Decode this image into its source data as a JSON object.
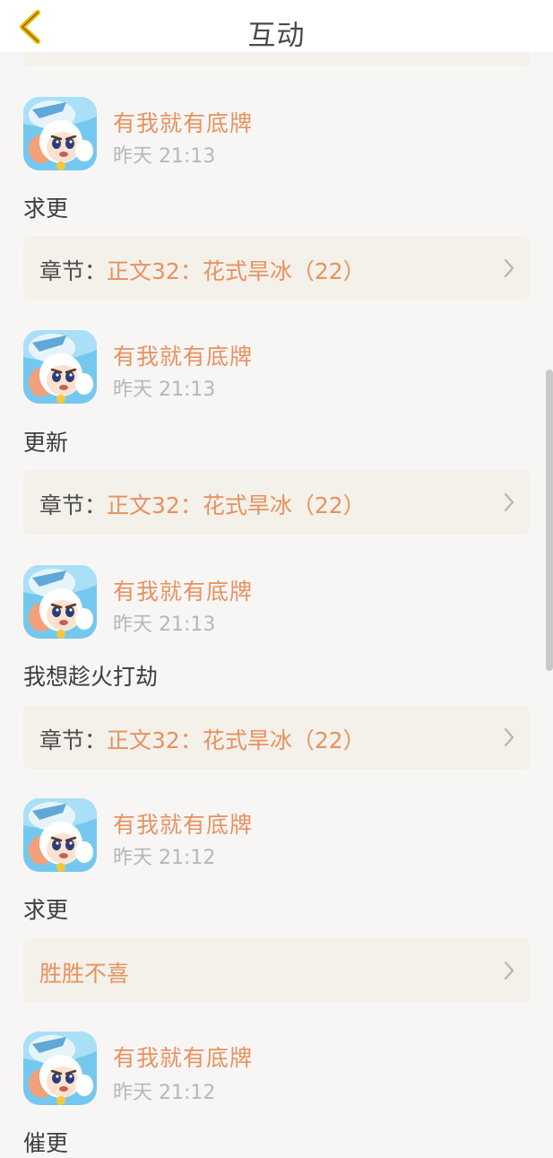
{
  "header": {
    "title": "互动"
  },
  "items": [
    {
      "username": "有我就有底牌",
      "time": "昨天 21:13",
      "content": "求更",
      "ref_prefix": "章节：",
      "ref_title": "正文32：花式旱冰（22）"
    },
    {
      "username": "有我就有底牌",
      "time": "昨天 21:13",
      "content": "更新",
      "ref_prefix": "章节：",
      "ref_title": "正文32：花式旱冰（22）"
    },
    {
      "username": "有我就有底牌",
      "time": "昨天 21:13",
      "content": "我想趁火打劫",
      "ref_prefix": "章节：",
      "ref_title": "正文32：花式旱冰（22）"
    },
    {
      "username": "有我就有底牌",
      "time": "昨天 21:12",
      "content": "求更",
      "ref_prefix": "",
      "ref_title": "胜胜不喜"
    },
    {
      "username": "有我就有底牌",
      "time": "昨天 21:12",
      "content": "催更"
    }
  ],
  "colors": {
    "accent": "#e8915f",
    "card_bg": "#f3f1ea",
    "page_bg": "#f8f6f5",
    "back_icon": "#f0b400"
  },
  "icons": {
    "back": "chevron-left-icon",
    "card_arrow": "chevron-right-icon",
    "avatar": "cartoon-goat-avatar"
  }
}
